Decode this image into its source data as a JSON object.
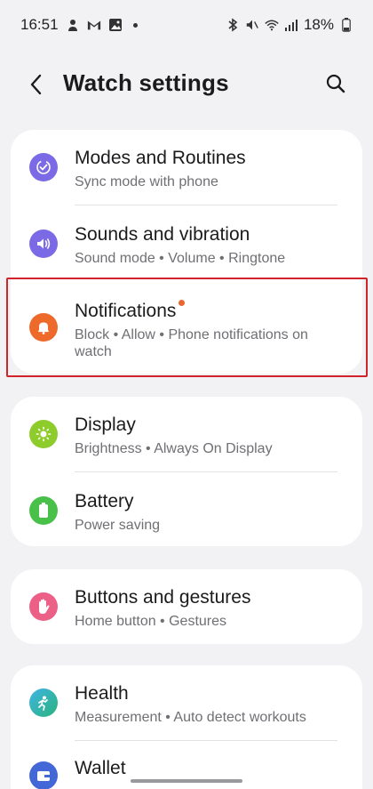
{
  "status_bar": {
    "time": "16:51",
    "battery": "18%",
    "left_icons": [
      "person-icon",
      "gmail-icon",
      "gallery-icon",
      "dot-icon"
    ],
    "right_icons": [
      "bluetooth-icon",
      "mute-vibrate-icon",
      "wifi-icon",
      "signal-icon",
      "battery-icon"
    ]
  },
  "header": {
    "title": "Watch settings",
    "back_icon": "chevron-left-icon",
    "search_icon": "search-icon"
  },
  "colors": {
    "modes": "#7b6ae6",
    "sounds": "#7b6ae6",
    "notifications": "#ee6a2a",
    "display": "#8dcc2b",
    "battery": "#48c04a",
    "buttons": "#ec5f86",
    "health": "#2aaaa9",
    "wallet": "#4467d8",
    "highlight": "#d1232b"
  },
  "groups": [
    {
      "items": [
        {
          "title": "Modes and Routines",
          "subtitle": "Sync mode with phone",
          "icon": "modes-check-icon"
        },
        {
          "title": "Sounds and vibration",
          "subtitle": "Sound mode • Volume • Ringtone",
          "icon": "speaker-icon"
        },
        {
          "title": "Notifications",
          "subtitle": "Block • Allow • Phone notifications on watch",
          "icon": "bell-icon"
        }
      ]
    },
    {
      "items": [
        {
          "title": "Display",
          "subtitle": "Brightness • Always On Display",
          "icon": "sun-icon"
        },
        {
          "title": "Battery",
          "subtitle": "Power saving",
          "icon": "battery-icon"
        }
      ]
    },
    {
      "items": [
        {
          "title": "Buttons and gestures",
          "subtitle": "Home button • Gestures",
          "icon": "hand-icon"
        }
      ]
    },
    {
      "items": [
        {
          "title": "Health",
          "subtitle": "Measurement • Auto detect workouts",
          "icon": "health-icon"
        },
        {
          "title": "Wallet",
          "subtitle": "",
          "icon": "wallet-icon"
        }
      ]
    }
  ]
}
